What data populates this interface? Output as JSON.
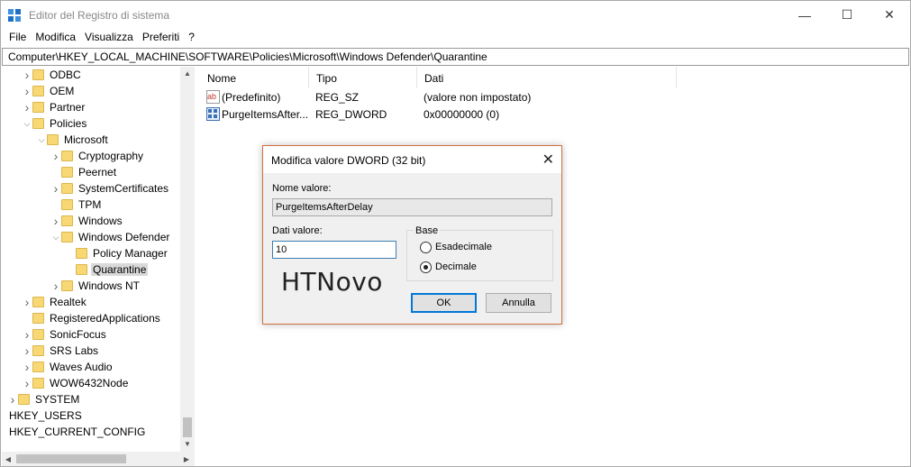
{
  "window": {
    "title": "Editor del Registro di sistema",
    "minimize_glyph": "—",
    "maximize_glyph": "☐",
    "close_glyph": "✕"
  },
  "menu": [
    "File",
    "Modifica",
    "Visualizza",
    "Preferiti",
    "?"
  ],
  "address": "Computer\\HKEY_LOCAL_MACHINE\\SOFTWARE\\Policies\\Microsoft\\Windows Defender\\Quarantine",
  "tree": {
    "nodes": [
      {
        "label": "ODBC",
        "state": "collapsed"
      },
      {
        "label": "OEM",
        "state": "collapsed"
      },
      {
        "label": "Partner",
        "state": "collapsed"
      },
      {
        "label": "Policies",
        "state": "expanded"
      },
      {
        "label": "Microsoft",
        "state": "expanded"
      },
      {
        "label": "Cryptography",
        "state": "collapsed"
      },
      {
        "label": "Peernet",
        "state": "none"
      },
      {
        "label": "SystemCertificates",
        "state": "collapsed"
      },
      {
        "label": "TPM",
        "state": "none"
      },
      {
        "label": "Windows",
        "state": "collapsed"
      },
      {
        "label": "Windows Defender",
        "state": "expanded"
      },
      {
        "label": "Policy Manager",
        "state": "none"
      },
      {
        "label": "Quarantine",
        "state": "none",
        "selected": true
      },
      {
        "label": "Windows NT",
        "state": "collapsed"
      },
      {
        "label": "Realtek",
        "state": "collapsed"
      },
      {
        "label": "RegisteredApplications",
        "state": "none"
      },
      {
        "label": "SonicFocus",
        "state": "collapsed"
      },
      {
        "label": "SRS Labs",
        "state": "collapsed"
      },
      {
        "label": "Waves Audio",
        "state": "collapsed"
      },
      {
        "label": "WOW6432Node",
        "state": "collapsed"
      },
      {
        "label": "SYSTEM",
        "state": "collapsed"
      },
      {
        "label": "HKEY_USERS",
        "state": "collapsed"
      },
      {
        "label": "HKEY_CURRENT_CONFIG",
        "state": "collapsed"
      }
    ]
  },
  "values": {
    "columns": [
      "Nome",
      "Tipo",
      "Dati"
    ],
    "rows": [
      {
        "name": "(Predefinito)",
        "type": "REG_SZ",
        "data": "(valore non impostato)",
        "icon": "string-value-icon"
      },
      {
        "name": "PurgeItemsAfter...",
        "type": "REG_DWORD",
        "data": "0x00000000 (0)",
        "icon": "binary-value-icon"
      }
    ]
  },
  "dialog": {
    "title": "Modifica valore DWORD (32 bit)",
    "close_glyph": "✕",
    "name_label": "Nome valore:",
    "name_value": "PurgeItemsAfterDelay",
    "data_label": "Dati valore:",
    "data_value": "10",
    "base_label": "Base",
    "radio_hex": "Esadecimale",
    "radio_dec": "Decimale",
    "selected_base": "Decimale",
    "watermark": "HTNovo",
    "ok_label": "OK",
    "cancel_label": "Annulla"
  },
  "colors": {
    "folder": "#f8d775",
    "selection": "#d9d9d9",
    "dialog_border": "#d0703f",
    "default_button": "#0078d7"
  }
}
